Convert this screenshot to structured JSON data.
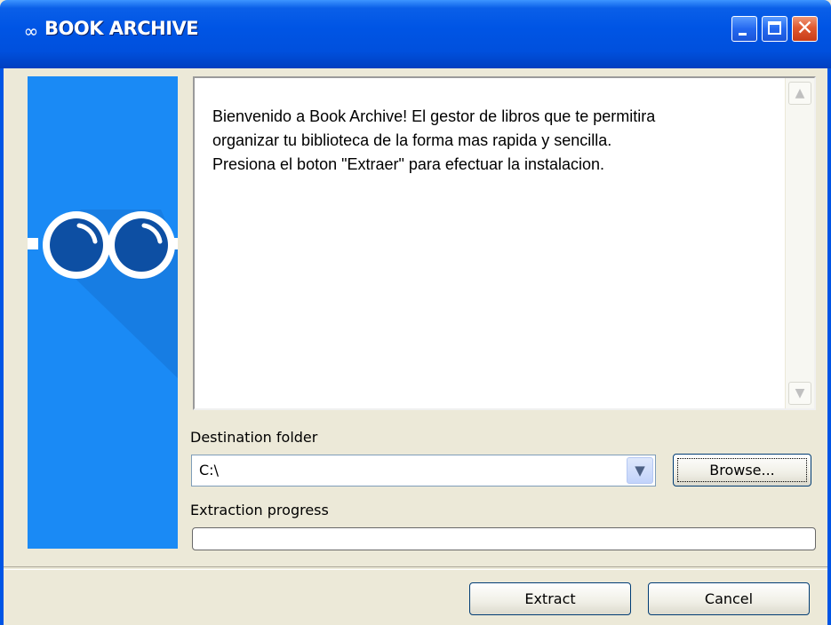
{
  "window": {
    "title": "BOOK ARCHIVE",
    "icon": "infinity-icon"
  },
  "title_buttons": {
    "minimize": "minimize-icon",
    "maximize": "maximize-icon",
    "close": "close-icon"
  },
  "banner": {
    "icon": "glasses-icon",
    "background": "#1a8af5"
  },
  "welcome": {
    "text": "Bienvenido a Book Archive! El gestor de libros que te permitira\norganizar tu biblioteca de la forma mas rapida y sencilla.\nPresiona el boton \"Extraer\" para efectuar la instalacion."
  },
  "destination": {
    "label": "Destination folder",
    "value": "C:\\",
    "browse_label": "Browse..."
  },
  "progress": {
    "label": "Extraction progress",
    "value": 0
  },
  "actions": {
    "extract_label": "Extract",
    "cancel_label": "Cancel"
  },
  "colors": {
    "titlebar": "#0055e5",
    "window_bg": "#ece9d8",
    "accent": "#1a8af5"
  }
}
